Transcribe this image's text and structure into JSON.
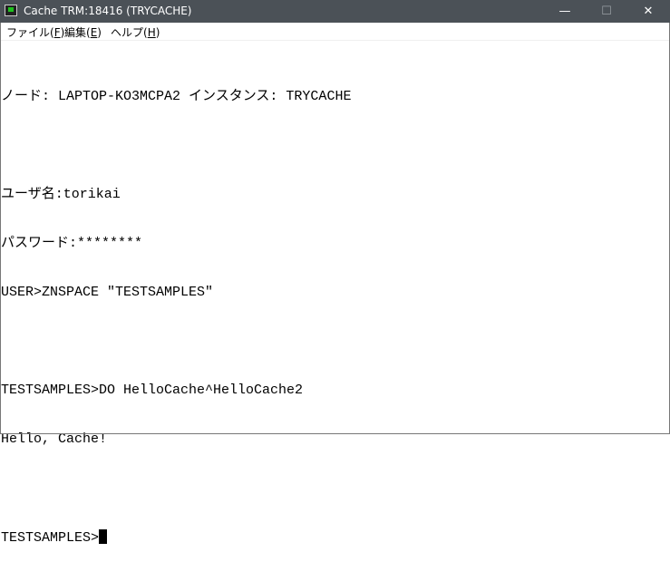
{
  "window": {
    "title": "Cache TRM:18416 (TRYCACHE)",
    "minimize": "—",
    "maximize": "☐",
    "close": "✕"
  },
  "menu": [
    {
      "label": "ファイル(",
      "key": "F",
      "end": ")"
    },
    {
      "label": "編集(",
      "key": "E",
      "end": ")"
    },
    {
      "label": "ヘルプ(",
      "key": "H",
      "end": ")"
    }
  ],
  "terminal": {
    "lines": [
      "ノード: LAPTOP-KO3MCPA2 インスタンス: TRYCACHE",
      "",
      "ユーザ名:torikai",
      "パスワード:********",
      "USER>ZNSPACE \"TESTSAMPLES\"",
      "",
      "TESTSAMPLES>DO HelloCache^HelloCache2",
      "Hello, Cache!",
      "",
      "TESTSAMPLES>"
    ]
  }
}
